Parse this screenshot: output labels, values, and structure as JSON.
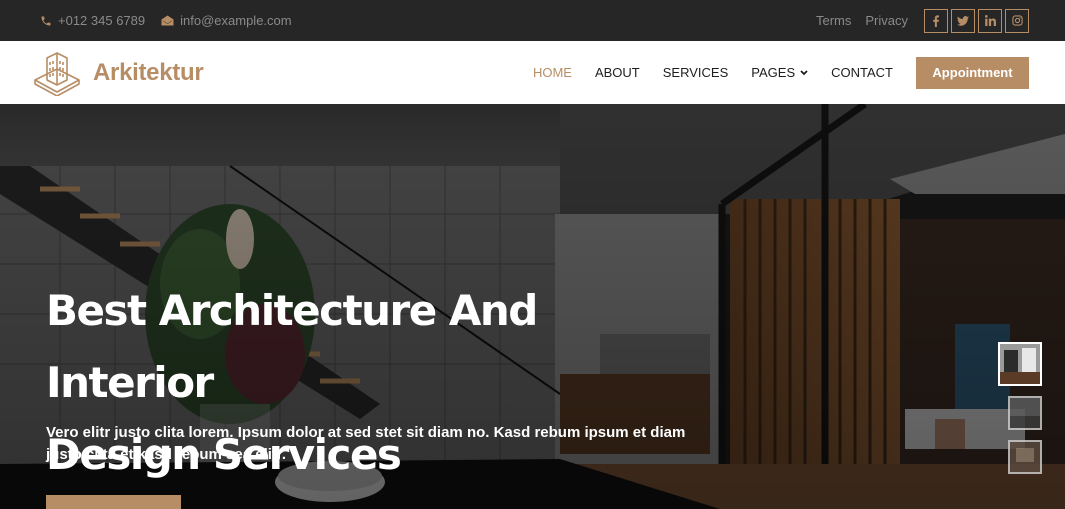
{
  "topbar": {
    "phone": "+012 345 6789",
    "email": "info@example.com",
    "links": [
      "Terms",
      "Privacy"
    ],
    "socials": [
      "f",
      "t",
      "in",
      "ig"
    ]
  },
  "brand": {
    "name": "Arkitektur"
  },
  "nav": {
    "items": [
      "HOME",
      "ABOUT",
      "SERVICES",
      "PAGES",
      "CONTACT"
    ],
    "active": "HOME",
    "cta": "Appointment"
  },
  "hero": {
    "title_line1": "Best Architecture And Interior",
    "title_line2": "Design Services",
    "subtitle": "Vero elitr justo clita lorem. Ipsum dolor at sed stet sit diam no. Kasd rebum ipsum et diam justo clita et kasd rebum sea elitr.",
    "thumbnail_count": 3
  },
  "colors": {
    "accent": "#b78d65",
    "topbar": "#262626",
    "nav_bg": "#ffffff"
  }
}
